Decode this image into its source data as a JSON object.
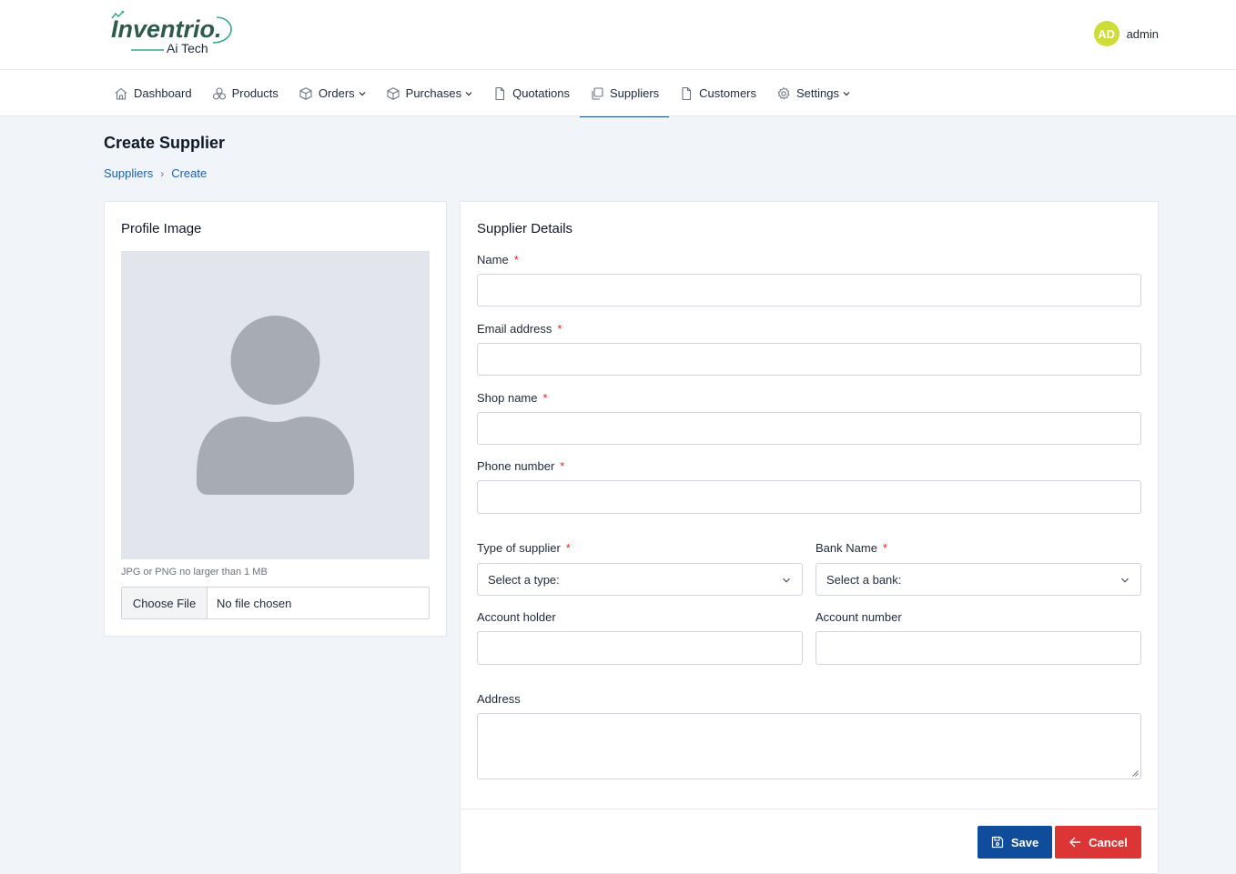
{
  "brand": {
    "name": "Inventrio.",
    "tagline": "Ai Tech",
    "color": "#2d5a4c",
    "accent": "#2ea88a"
  },
  "user": {
    "initials": "AD",
    "name": "admin",
    "avatar_color": "#cddc39"
  },
  "nav": {
    "items": [
      {
        "label": "Dashboard",
        "icon": "home-icon"
      },
      {
        "label": "Products",
        "icon": "boxes-icon"
      },
      {
        "label": "Orders",
        "icon": "box-icon",
        "dropdown": true
      },
      {
        "label": "Purchases",
        "icon": "box-icon",
        "dropdown": true
      },
      {
        "label": "Quotations",
        "icon": "document-icon"
      },
      {
        "label": "Suppliers",
        "icon": "copy-icon",
        "active": true
      },
      {
        "label": "Customers",
        "icon": "document-icon"
      },
      {
        "label": "Settings",
        "icon": "gear-icon",
        "dropdown": true
      }
    ]
  },
  "page": {
    "title": "Create Supplier",
    "breadcrumb": [
      "Suppliers",
      "Create"
    ],
    "breadcrumb_sep": "›"
  },
  "profile": {
    "title": "Profile Image",
    "hint": "JPG or PNG no larger than 1 MB",
    "choose_label": "Choose File",
    "file_text": "No file chosen"
  },
  "details": {
    "title": "Supplier Details",
    "fields": {
      "name": {
        "label": "Name",
        "value": ""
      },
      "email": {
        "label": "Email address",
        "value": ""
      },
      "shop": {
        "label": "Shop name",
        "value": ""
      },
      "phone": {
        "label": "Phone number",
        "value": ""
      },
      "type": {
        "label": "Type of supplier",
        "selected": "Select a type:"
      },
      "bank": {
        "label": "Bank Name",
        "selected": "Select a bank:"
      },
      "account_holder": {
        "label": "Account holder",
        "value": ""
      },
      "account_number": {
        "label": "Account number",
        "value": ""
      },
      "address": {
        "label": "Address",
        "value": ""
      }
    },
    "required_mark": "*"
  },
  "actions": {
    "save_label": "Save",
    "cancel_label": "Cancel",
    "save_color": "#0f4c9c",
    "cancel_color": "#dc3535"
  }
}
